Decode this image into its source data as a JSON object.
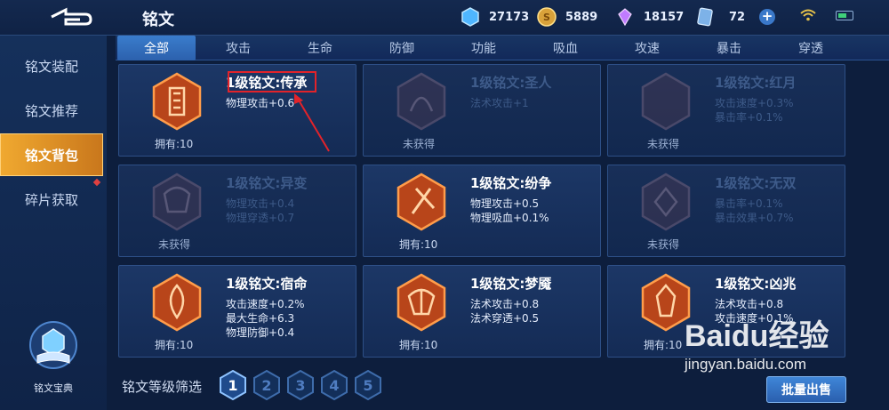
{
  "header": {
    "title": "铭文",
    "resources": [
      {
        "icon": "diamond-icon",
        "value": "27173"
      },
      {
        "icon": "gold-coin-icon",
        "value": "5889"
      },
      {
        "icon": "crystal-icon",
        "value": "18157"
      },
      {
        "icon": "card-icon",
        "value": "72"
      }
    ]
  },
  "sidebar": {
    "items": [
      {
        "label": "铭文装配"
      },
      {
        "label": "铭文推荐"
      },
      {
        "label": "铭文背包"
      },
      {
        "label": "碎片获取"
      }
    ],
    "codex_label": "铭文宝典"
  },
  "tabs": [
    "全部",
    "攻击",
    "生命",
    "防御",
    "功能",
    "吸血",
    "攻速",
    "暴击",
    "穿透"
  ],
  "cards": [
    {
      "name": "1级铭文:传承",
      "stats": [
        "物理攻击+0.6"
      ],
      "owned": "拥有:10",
      "color": "#e0641e"
    },
    {
      "name": "1级铭文:圣人",
      "stats": [
        "法术攻击+1"
      ],
      "owned": "未获得",
      "color": "#5a4a6a"
    },
    {
      "name": "1级铭文:红月",
      "stats": [
        "攻击速度+0.3%",
        "暴击率+0.1%"
      ],
      "owned": "未获得",
      "color": "#5a4a6a"
    },
    {
      "name": "1级铭文:异变",
      "stats": [
        "物理攻击+0.4",
        "物理穿透+0.7"
      ],
      "owned": "未获得",
      "color": "#5a4a6a"
    },
    {
      "name": "1级铭文:纷争",
      "stats": [
        "物理攻击+0.5",
        "物理吸血+0.1%"
      ],
      "owned": "拥有:10",
      "color": "#e0641e"
    },
    {
      "name": "1级铭文:无双",
      "stats": [
        "暴击率+0.1%",
        "暴击效果+0.7%"
      ],
      "owned": "未获得",
      "color": "#5a4a6a"
    },
    {
      "name": "1级铭文:宿命",
      "stats": [
        "攻击速度+0.2%",
        "最大生命+6.3",
        "物理防御+0.4"
      ],
      "owned": "拥有:10",
      "color": "#e0641e"
    },
    {
      "name": "1级铭文:梦魇",
      "stats": [
        "法术攻击+0.8",
        "法术穿透+0.5"
      ],
      "owned": "拥有:10",
      "color": "#e0641e"
    },
    {
      "name": "1级铭文:凶兆",
      "stats": [
        "法术攻击+0.8",
        "攻击速度+0.1%"
      ],
      "owned": "拥有:10",
      "color": "#e0641e"
    }
  ],
  "filter": {
    "label": "铭文等级筛选",
    "levels": [
      "1",
      "2",
      "3",
      "4",
      "5"
    ],
    "selected": "1"
  },
  "sell_button": "批量出售",
  "watermark": {
    "logo": "Baidu经验",
    "url": "jingyan.baidu.com"
  }
}
